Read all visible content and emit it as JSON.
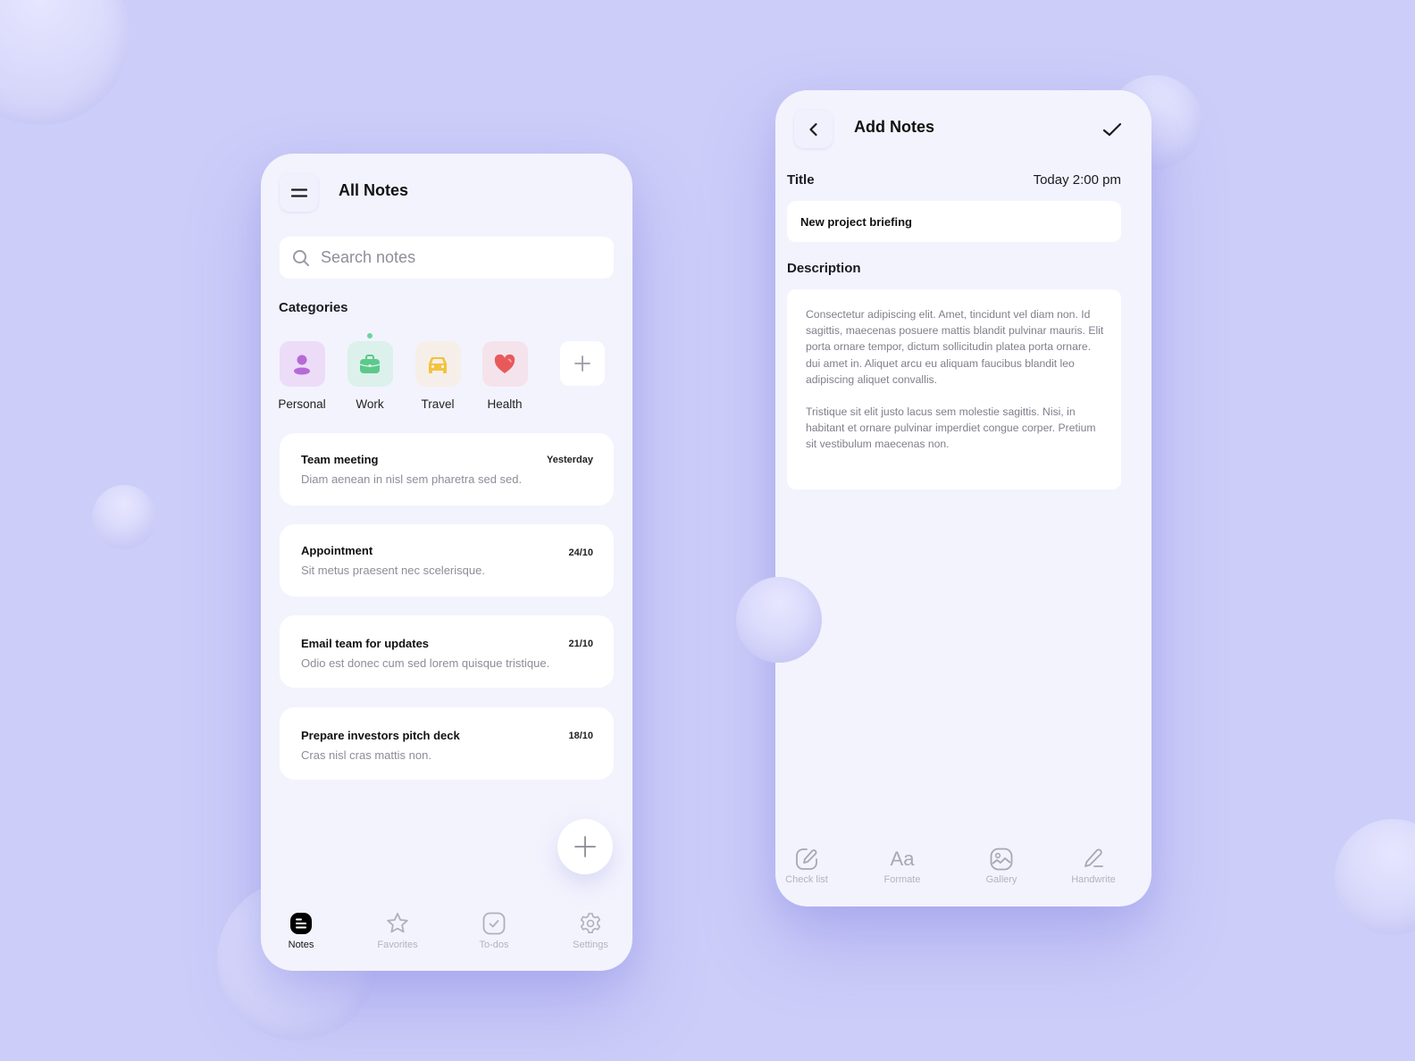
{
  "colors": {
    "background": "#cdcdf9",
    "phone_bg": "#f3f3fe",
    "personal": "#b66ad6",
    "work": "#5cc98a",
    "travel": "#f4c23c",
    "health": "#e85a5a",
    "active_dot": "#6ad6a0"
  },
  "all_notes": {
    "title": "All Notes",
    "menu_icon": "menu-icon",
    "search": {
      "placeholder": "Search notes",
      "value": ""
    },
    "categories_label": "Categories",
    "categories": [
      {
        "label": "Personal",
        "icon": "person-icon",
        "active": false
      },
      {
        "label": "Work",
        "icon": "briefcase-icon",
        "active": true
      },
      {
        "label": "Travel",
        "icon": "car-icon",
        "active": false
      },
      {
        "label": "Health",
        "icon": "heart-icon",
        "active": false
      }
    ],
    "add_category_icon": "plus-icon",
    "notes": [
      {
        "title": "Team meeting",
        "date": "Yesterday",
        "body": "Diam aenean in nisl sem pharetra sed sed."
      },
      {
        "title": "Appointment",
        "date": "24/10",
        "body": "Sit metus praesent nec scelerisque."
      },
      {
        "title": "Email team for updates",
        "date": "21/10",
        "body": "Odio est donec cum sed lorem quisque tristique."
      },
      {
        "title": "Prepare investors pitch deck",
        "date": "18/10",
        "body": "Cras nisl cras mattis non."
      }
    ],
    "fab_icon": "plus-icon",
    "nav": [
      {
        "label": "Notes",
        "icon": "notes-icon",
        "active": true
      },
      {
        "label": "Favorites",
        "icon": "star-icon",
        "active": false
      },
      {
        "label": "To-dos",
        "icon": "checkbox-icon",
        "active": false
      },
      {
        "label": "Settings",
        "icon": "gear-icon",
        "active": false
      }
    ]
  },
  "add_note": {
    "title": "Add Notes",
    "back_icon": "chevron-left-icon",
    "save_icon": "check-icon",
    "title_label": "Title",
    "timestamp": "Today 2:00 pm",
    "title_value": "New project briefing",
    "description_label": "Description",
    "description": [
      "Consectetur adipiscing elit. Amet, tincidunt vel diam non. Id sagittis, maecenas posuere mattis blandit pulvinar mauris. Elit porta ornare tempor, dictum sollicitudin platea porta ornare.\ndui amet in. Aliquet arcu eu aliquam faucibus blandit leo adipiscing aliquet convallis.",
      "Tristique sit elit justo lacus sem molestie sagittis. Nisi, in habitant et ornare pulvinar imperdiet congue corper. Pretium sit vestibulum maecenas non."
    ],
    "tools": [
      {
        "label": "Check list",
        "icon": "edit-circle-icon"
      },
      {
        "label": "Formate",
        "icon": "text-format-icon",
        "glyph": "Aa"
      },
      {
        "label": "Gallery",
        "icon": "image-icon"
      },
      {
        "label": "Handwrite",
        "icon": "pen-icon"
      }
    ]
  }
}
